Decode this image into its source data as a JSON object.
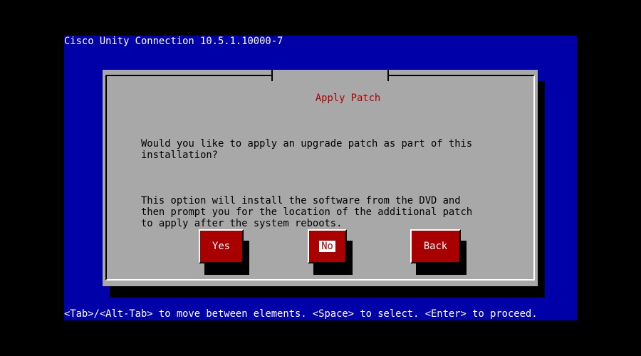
{
  "header": {
    "product_version": "Cisco Unity Connection 10.5.1.10000-7"
  },
  "dialog": {
    "title": "Apply Patch",
    "paragraphs": [
      "Would you like to apply an upgrade patch as part of this\ninstallation?",
      "This option will install the software from the DVD and\nthen prompt you for the location of the additional patch\nto apply after the system reboots."
    ],
    "buttons": {
      "yes": "Yes",
      "no": "No",
      "back": "Back"
    },
    "focused_button": "No"
  },
  "footer": {
    "help": "<Tab>/<Alt-Tab> to move between elements. <Space> to select. <Enter> to proceed."
  },
  "colors": {
    "background": "#0000a8",
    "dialog": "#a8a8a8",
    "accent": "#a80000",
    "text": "#000000",
    "highlight_text": "#ffffff"
  }
}
